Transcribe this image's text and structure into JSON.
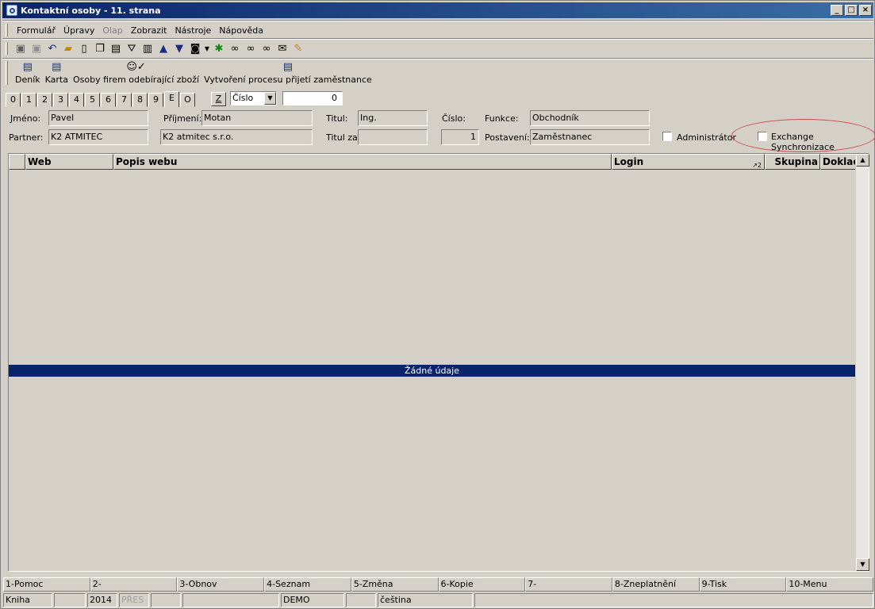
{
  "window": {
    "title": "Kontaktní osoby - 11. strana",
    "buttons": {
      "minimize": "_",
      "maximize": "□",
      "close": "×"
    }
  },
  "menu": [
    "Formulář",
    "Úpravy",
    "Olap",
    "Zobrazit",
    "Nástroje",
    "Nápověda"
  ],
  "toolbar_icons": [
    "save-icon",
    "save-as-icon",
    "undo-icon",
    "open-icon",
    "new-icon",
    "copy-icon",
    "book-icon",
    "filter-icon",
    "filter-doc-icon",
    "arrow-up-icon",
    "arrow-down-icon",
    "camera-icon",
    "dropdown-icon",
    "run-icon",
    "binoculars-icon",
    "binoculars-next-icon",
    "binoculars-prev-icon",
    "mail-icon",
    "notes-icon"
  ],
  "toolbar2": [
    {
      "label": "Deník",
      "icon": "document-icon"
    },
    {
      "label": "Karta",
      "icon": "document-icon"
    },
    {
      "label": "Osoby firem odebírající zboží",
      "icon": "person-check-icon"
    },
    {
      "label": "Vytvoření procesu přijetí zaměstnance",
      "icon": "document-icon"
    }
  ],
  "tabs": [
    "0",
    "1",
    "2",
    "3",
    "4",
    "5",
    "6",
    "7",
    "8",
    "9",
    "E",
    "O"
  ],
  "active_tab": "E",
  "z_button": "Z",
  "sort_select": {
    "value": "Číslo"
  },
  "number_box": "0",
  "form": {
    "jmeno_label": "Jméno:",
    "jmeno": "Pavel",
    "prijmeni_label": "Příjmení:",
    "prijmeni": "Motan",
    "titul_label": "Titul:",
    "titul": "Ing.",
    "cislo_label": "Číslo:",
    "cislo": "1",
    "funkce_label": "Funkce:",
    "funkce": "Obchodník",
    "partner_label": "Partner:",
    "partner_code": "K2 ATMITEC",
    "partner_name": "K2 atmitec s.r.o.",
    "titul_za_label": "Titul za:",
    "titul_za": "",
    "postaveni_label": "Postavení:",
    "postaveni": "Zaměstnanec",
    "administrator_label": "Administrátor",
    "exchange_label": "Exchange Synchronizace"
  },
  "grid": {
    "columns": [
      "",
      "Web",
      "Popis webu",
      "Login",
      "Skupina",
      "Doklad"
    ],
    "sort_indicator": "↗2",
    "empty_text": "Žádné údaje"
  },
  "fkeys": [
    "1-Pomoc",
    "2-",
    "3-Obnov",
    "4-Seznam",
    "5-Změna",
    "6-Kopie",
    "7-",
    "8-Zneplatnění",
    "9-Tisk",
    "10-Menu"
  ],
  "status": [
    "Kniha",
    "",
    "2014",
    "PŘES",
    "",
    "",
    "DEMO",
    "",
    "čeština",
    ""
  ]
}
